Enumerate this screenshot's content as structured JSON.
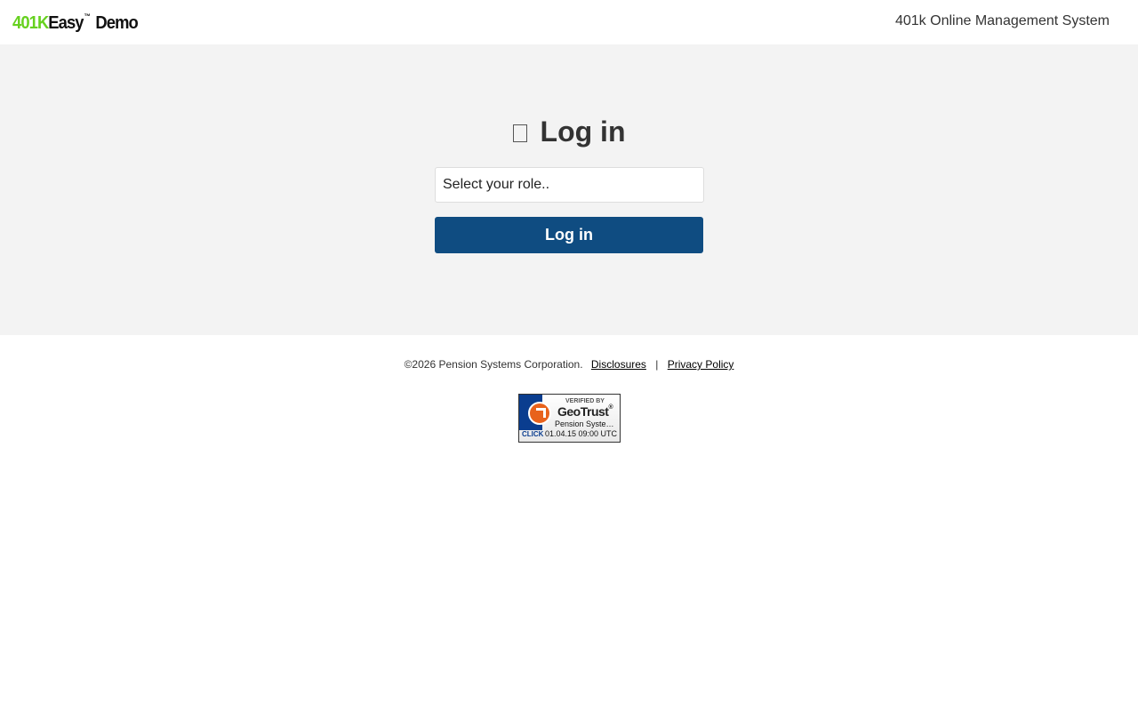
{
  "header": {
    "logo": {
      "brand_number": "401K",
      "brand_name": "Easy",
      "trademark": "™",
      "suffix": "Demo",
      "brand_color": "#66d11f"
    },
    "tagline": "401k Online Management System"
  },
  "login": {
    "icon": "lock-icon",
    "title": "Log in",
    "role_select": {
      "value": "Select your role.."
    },
    "button_label": "Log in",
    "button_color": "#0f4c81",
    "band_color": "#f3f3f3"
  },
  "footer": {
    "copyright": "©2026 Pension Systems Corporation.",
    "disclosures_label": "Disclosures",
    "separator": "|",
    "privacy_label": "Privacy Policy",
    "seal": {
      "verified_text": "VERIFIED BY",
      "brand": "GeoTrust",
      "trademark": "®",
      "owner": "Pension Syste…",
      "click_text": "CLICK",
      "date": "01.04.15 09:00 UTC"
    }
  }
}
